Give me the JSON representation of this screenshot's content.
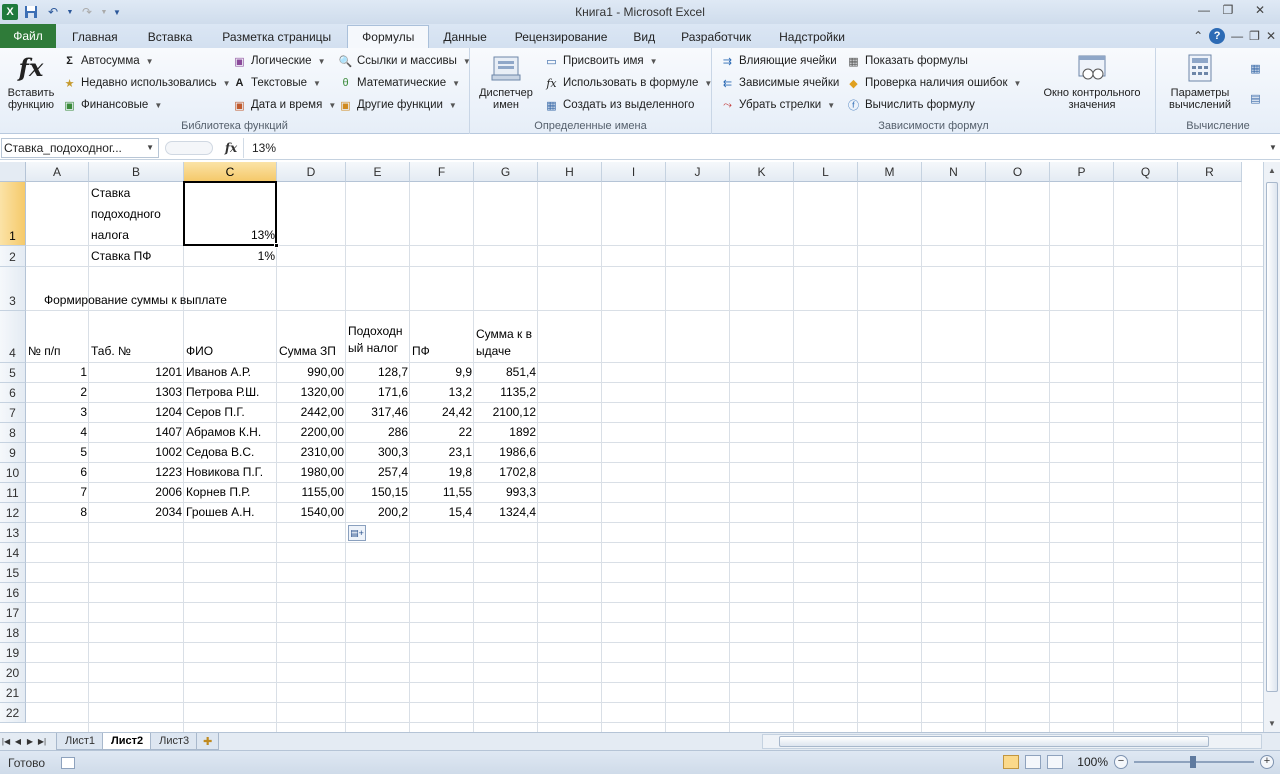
{
  "app": {
    "title": "Книга1  -  Microsoft Excel",
    "file_tab": "Файл",
    "tabs": [
      "Главная",
      "Вставка",
      "Разметка страницы",
      "Формулы",
      "Данные",
      "Рецензирование",
      "Вид",
      "Разработчик",
      "Надстройки"
    ],
    "active_tab": "Формулы"
  },
  "ribbon": {
    "library": {
      "label": "Библиотека функций",
      "insert_function": "Вставить функцию",
      "items": [
        "Автосумма",
        "Недавно использовались",
        "Финансовые",
        "Логические",
        "Текстовые",
        "Дата и время",
        "Ссылки и массивы",
        "Математические",
        "Другие функции"
      ]
    },
    "names": {
      "label": "Определенные имена",
      "manager": "Диспетчер имен",
      "items": [
        "Присвоить имя",
        "Использовать в формуле",
        "Создать из выделенного"
      ]
    },
    "audit": {
      "label": "Зависимости формул",
      "items": [
        "Влияющие ячейки",
        "Зависимые ячейки",
        "Убрать стрелки",
        "Показать формулы",
        "Проверка наличия ошибок",
        "Вычислить формулу"
      ],
      "watch": "Окно контрольного значения"
    },
    "calc": {
      "label": "Вычисление",
      "options": "Параметры вычислений"
    }
  },
  "formula_bar": {
    "name_box": "Ставка_подоходног...",
    "fx": "fx",
    "value": "13%"
  },
  "grid": {
    "columns": [
      "A",
      "B",
      "C",
      "D",
      "E",
      "F",
      "G",
      "H",
      "I",
      "J",
      "K",
      "L",
      "M",
      "N",
      "O",
      "P",
      "Q",
      "R"
    ],
    "selected_column": "C",
    "rows": [
      "1",
      "2",
      "3",
      "4",
      "5",
      "6",
      "7",
      "8",
      "9",
      "10",
      "11",
      "12",
      "13",
      "14",
      "15",
      "16",
      "17",
      "18",
      "19",
      "20",
      "21",
      "22"
    ],
    "selected_row": "1",
    "cells": {
      "B1": "Ставка подоходного налога",
      "C1": "13%",
      "B2": "Ставка ПФ",
      "C2": "1%",
      "A3": "Формирование суммы к выплате",
      "headers": [
        "№ п/п",
        "Таб. №",
        "ФИО",
        "Сумма ЗП",
        "Подоходный налог",
        "ПФ",
        "Сумма к выдаче"
      ],
      "data": [
        [
          "1",
          "1201",
          "Иванов А.Р.",
          "990,00",
          "128,7",
          "9,9",
          "851,4"
        ],
        [
          "2",
          "1303",
          "Петрова Р.Ш.",
          "1320,00",
          "171,6",
          "13,2",
          "1135,2"
        ],
        [
          "3",
          "1204",
          "Серов П.Г.",
          "2442,00",
          "317,46",
          "24,42",
          "2100,12"
        ],
        [
          "4",
          "1407",
          "Абрамов К.Н.",
          "2200,00",
          "286",
          "22",
          "1892"
        ],
        [
          "5",
          "1002",
          "Седова В.С.",
          "2310,00",
          "300,3",
          "23,1",
          "1986,6"
        ],
        [
          "6",
          "1223",
          "Новикова П.Г.",
          "1980,00",
          "257,4",
          "19,8",
          "1702,8"
        ],
        [
          "7",
          "2006",
          "Корнев П.Р.",
          "1155,00",
          "150,15",
          "11,55",
          "993,3"
        ],
        [
          "8",
          "2034",
          "Грошев А.Н.",
          "1540,00",
          "200,2",
          "15,4",
          "1324,4"
        ]
      ]
    }
  },
  "sheets": {
    "tabs": [
      "Лист1",
      "Лист2",
      "Лист3"
    ],
    "active": "Лист2"
  },
  "status": {
    "text": "Готово",
    "zoom": "100%"
  }
}
